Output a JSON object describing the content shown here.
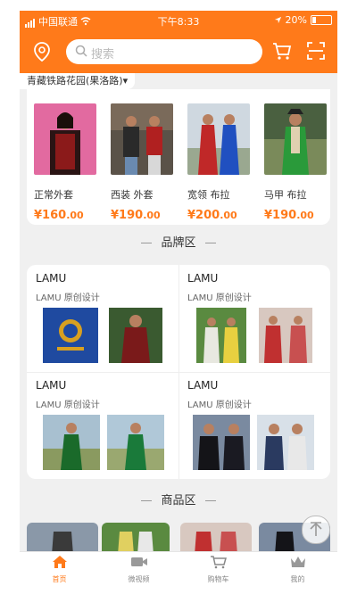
{
  "status_bar": {
    "carrier": "中国联通",
    "time": "下午8:33",
    "battery": "20%"
  },
  "header": {
    "search_placeholder": "搜索"
  },
  "location": {
    "text": "青藏铁路花园(果洛路)▾"
  },
  "products": [
    {
      "name": "正常外套",
      "price_main": "¥160",
      "price_dec": ".00"
    },
    {
      "name": "西装 外套",
      "price_main": "¥190",
      "price_dec": ".00"
    },
    {
      "name": "宽领 布拉",
      "price_main": "¥200",
      "price_dec": ".00"
    },
    {
      "name": "马甲 布拉",
      "price_main": "¥190",
      "price_dec": ".00"
    }
  ],
  "sections": {
    "brand": "品牌区",
    "goods": "商品区"
  },
  "brands": [
    {
      "name": "LAMU",
      "subtitle": "LAMU 原创设计"
    },
    {
      "name": "LAMU",
      "subtitle": "LAMU 原创设计"
    },
    {
      "name": "LAMU",
      "subtitle": "LAMU 原创设计"
    },
    {
      "name": "LAMU",
      "subtitle": "LAMU 原创设计"
    }
  ],
  "tabs": [
    {
      "label": "首页",
      "active": true
    },
    {
      "label": "微视频",
      "active": false
    },
    {
      "label": "购物车",
      "active": false
    },
    {
      "label": "我的",
      "active": false
    }
  ],
  "colors": {
    "accent": "#ff7a1a"
  }
}
